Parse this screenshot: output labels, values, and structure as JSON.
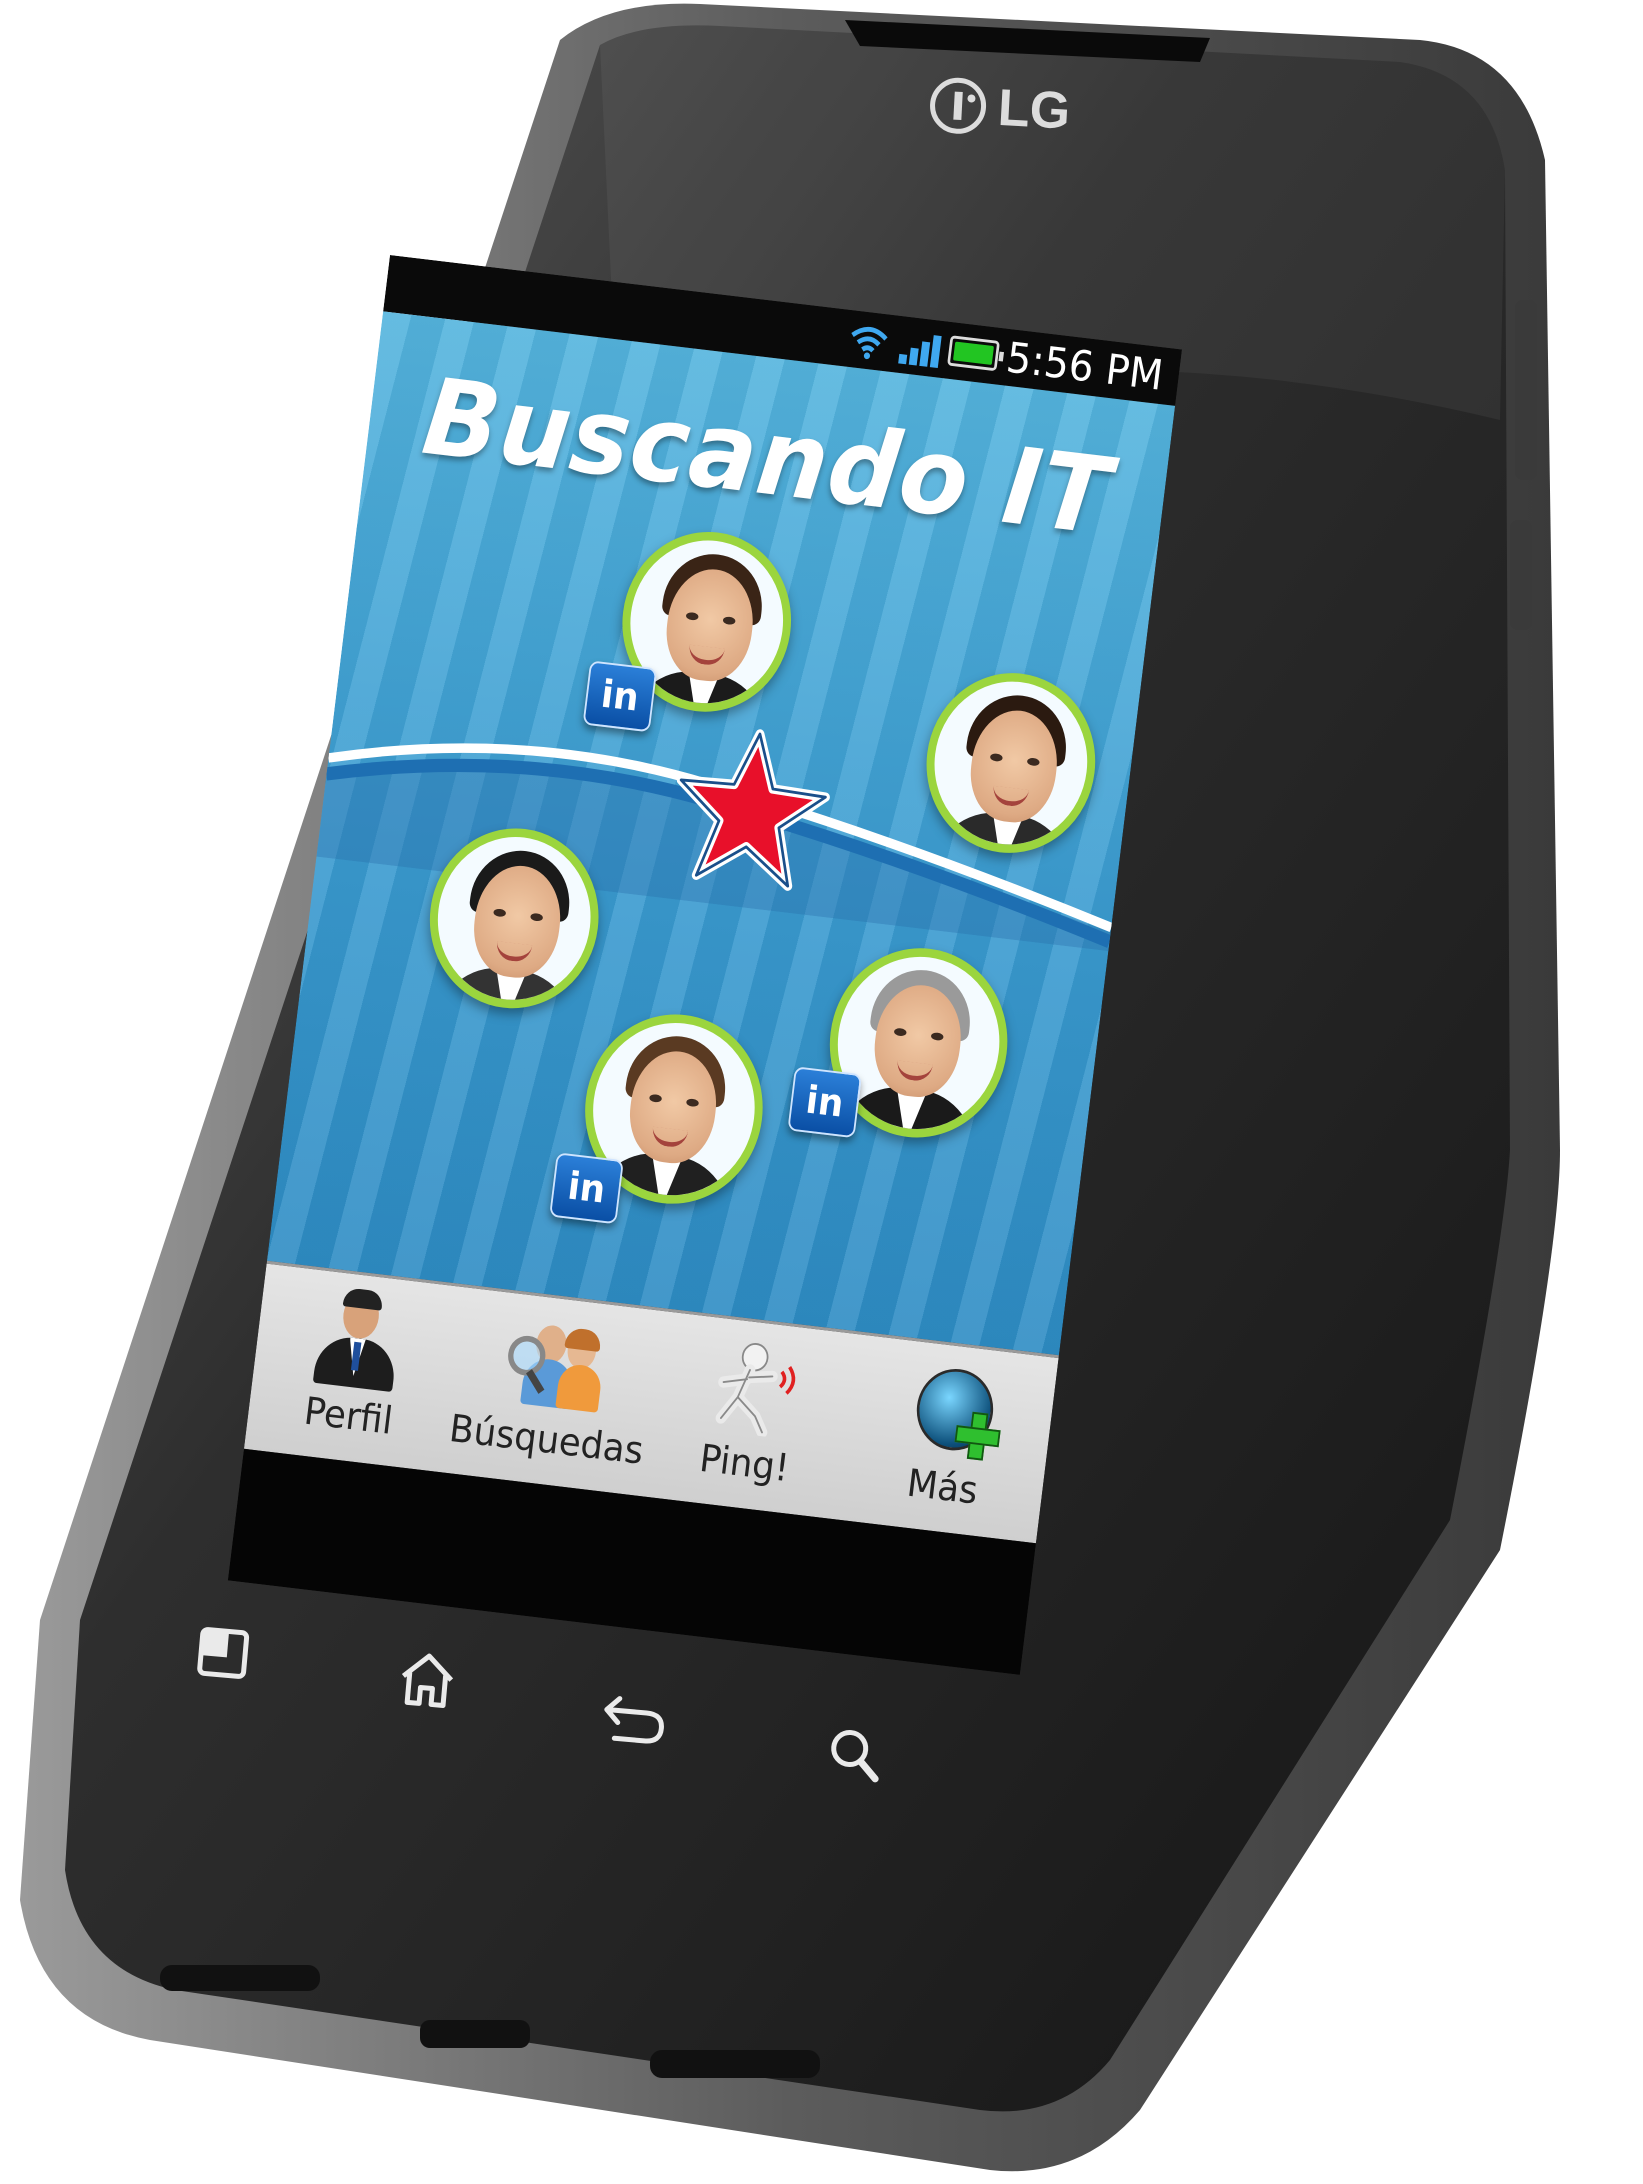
{
  "device": {
    "brand": "LG"
  },
  "status_bar": {
    "time": "5:56 PM",
    "icons": [
      "wifi-icon",
      "signal-icon",
      "battery-icon"
    ]
  },
  "app": {
    "title": "Buscando IT",
    "badge_text": "in",
    "accent_colors": {
      "title": "#ffffff",
      "star": "#e8102a",
      "ring": "#9bd53e",
      "background": "#3a9bd0"
    }
  },
  "nav": {
    "items": [
      {
        "label": "Perfil",
        "icon": "business-man-icon"
      },
      {
        "label": "Búsquedas",
        "icon": "people-search-icon"
      },
      {
        "label": "Ping!",
        "icon": "running-figure-icon"
      },
      {
        "label": "Más",
        "icon": "radar-plus-icon"
      }
    ]
  },
  "hardware_keys": [
    "menu-icon",
    "home-icon",
    "back-icon",
    "search-icon"
  ]
}
